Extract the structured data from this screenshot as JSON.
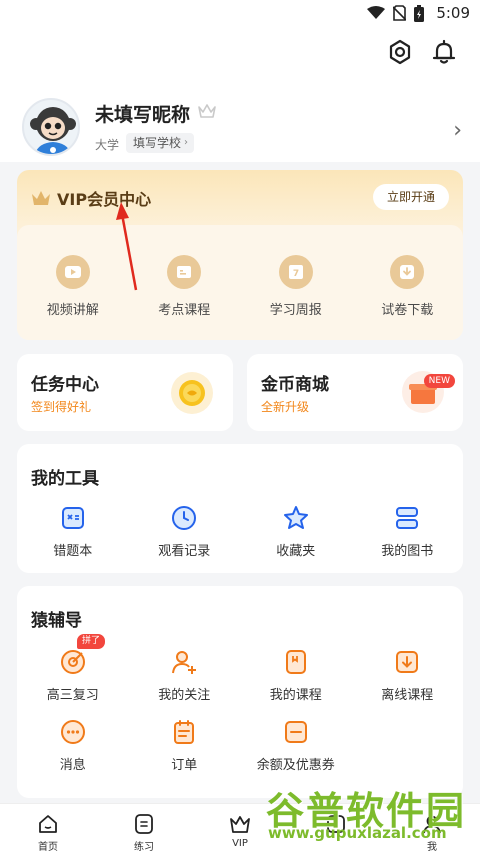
{
  "status_bar": {
    "time": "5:09"
  },
  "profile": {
    "nickname": "未填写昵称",
    "degree": "大学",
    "school": "填写学校"
  },
  "vip": {
    "title": "VIP会员中心",
    "open_label": "立即开通",
    "items": [
      {
        "label": "视频讲解",
        "icon": "play-icon"
      },
      {
        "label": "考点课程",
        "icon": "course-icon"
      },
      {
        "label": "学习周报",
        "icon": "calendar-icon"
      },
      {
        "label": "试卷下载",
        "icon": "download-icon"
      }
    ]
  },
  "task_center": {
    "title": "任务中心",
    "subtitle": "签到得好礼"
  },
  "coin_shop": {
    "title": "金币商城",
    "subtitle": "全新升级",
    "badge": "NEW"
  },
  "tools": {
    "title": "我的工具",
    "items": [
      {
        "label": "错题本",
        "icon": "mistakes-book-icon"
      },
      {
        "label": "观看记录",
        "icon": "history-clock-icon"
      },
      {
        "label": "收藏夹",
        "icon": "star-icon"
      },
      {
        "label": "我的图书",
        "icon": "books-icon"
      }
    ]
  },
  "fudao": {
    "title": "猿辅导",
    "badge": "拼了",
    "items": [
      {
        "label": "高三复习",
        "icon": "target-icon"
      },
      {
        "label": "我的关注",
        "icon": "follow-user-icon"
      },
      {
        "label": "我的课程",
        "icon": "my-course-icon"
      },
      {
        "label": "离线课程",
        "icon": "offline-download-icon"
      },
      {
        "label": "消息",
        "icon": "message-icon"
      },
      {
        "label": "订单",
        "icon": "order-icon"
      },
      {
        "label": "余额及优惠券",
        "icon": "coupon-icon"
      }
    ]
  },
  "tabs": [
    {
      "label": "首页",
      "icon": "home-icon"
    },
    {
      "label": "练习",
      "icon": "practice-icon"
    },
    {
      "label": "VIP",
      "icon": "vip-crown-icon"
    },
    {
      "label": "",
      "icon": "study-icon"
    },
    {
      "label": "我",
      "icon": "me-icon"
    }
  ],
  "watermark": {
    "text": "谷普软件园",
    "url": "www.gupuxlazal.com"
  },
  "colors": {
    "accent_orange": "#f2871b",
    "vip_gold": "#e9c998",
    "badge_red": "#f2463d",
    "icon_blue": "#3b82f6"
  }
}
